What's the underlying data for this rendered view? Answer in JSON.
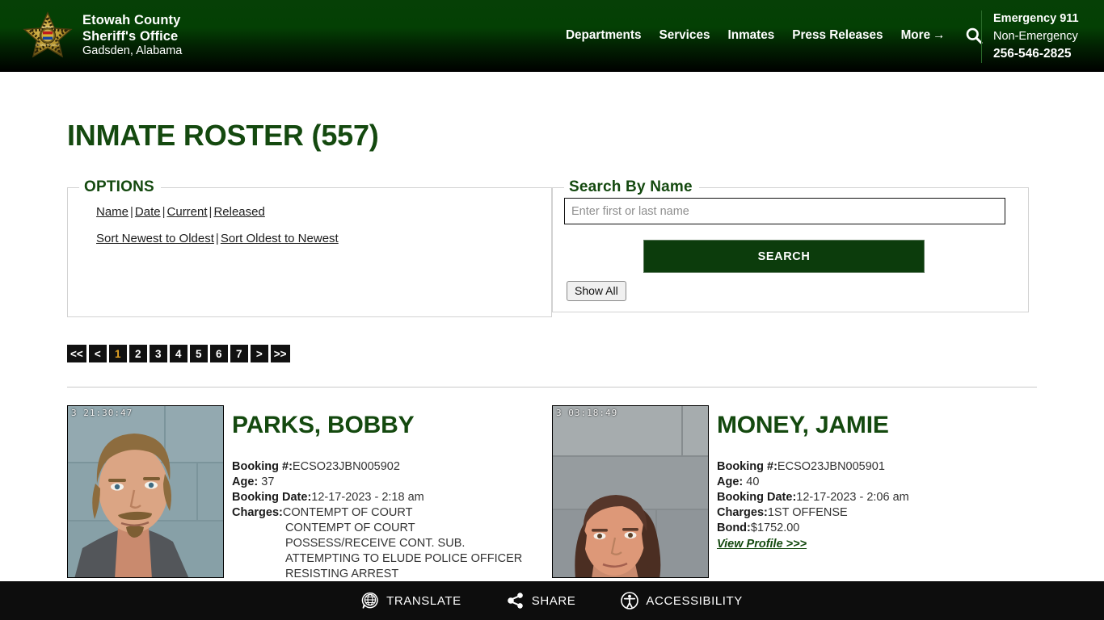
{
  "header": {
    "brand": {
      "line1": "Etowah County",
      "line2": "Sheriff's Office",
      "line3": "Gadsden, Alabama",
      "badge_icon": "sheriff-star-badge"
    },
    "nav": [
      {
        "label": "Departments"
      },
      {
        "label": "Services"
      },
      {
        "label": "Inmates"
      },
      {
        "label": "Press Releases"
      },
      {
        "label": "More",
        "arrow": "→"
      }
    ],
    "search_icon": "search-icon",
    "emergency": {
      "line1": "Emergency 911",
      "line2": "Non-Emergency",
      "line3": "256-546-2825"
    },
    "colors": {
      "green_top": "#064006",
      "black_bottom": "#000000"
    }
  },
  "page": {
    "title": "INMATE ROSTER (557)",
    "title_color": "#14490f"
  },
  "options": {
    "legend": "OPTIONS",
    "row1": [
      {
        "label": "Name"
      },
      {
        "label": "Date"
      },
      {
        "label": "Current"
      },
      {
        "label": "Released"
      }
    ],
    "row2": [
      {
        "label": "Sort Newest to Oldest"
      },
      {
        "label": "Sort Oldest to Newest"
      }
    ],
    "separator": "|"
  },
  "search": {
    "legend": "Search By Name",
    "placeholder": "Enter first or last name",
    "value": "",
    "button_label": "SEARCH",
    "show_all_label": "Show All",
    "button_color": "#0c3c0c"
  },
  "pagination": {
    "items": [
      "<<",
      "<",
      "1",
      "2",
      "3",
      "4",
      "5",
      "6",
      "7",
      ">",
      ">>"
    ],
    "active": "1",
    "active_color": "#e0a124",
    "background": "#111111"
  },
  "results": [
    {
      "name": "PARKS, BOBBY",
      "mug_timestamp": "3  21:30:47",
      "labels": {
        "booking": "Booking #:",
        "age": "Age:",
        "booking_date": "Booking Date:",
        "charges": "Charges:",
        "bond": "Bond:"
      },
      "booking_number": "ECSO23JBN005902",
      "age": "37",
      "booking_date": "12-17-2023 - 2:18 am",
      "charges": [
        "CONTEMPT OF COURT",
        "CONTEMPT OF COURT",
        "POSSESS/RECEIVE CONT. SUB.",
        "ATTEMPTING TO ELUDE POLICE OFFICER",
        "RESISTING ARREST"
      ],
      "bond": null,
      "profile_link": null
    },
    {
      "name": "MONEY, JAMIE",
      "mug_timestamp": "3  03:18:49",
      "labels": {
        "booking": "Booking #:",
        "age": "Age:",
        "booking_date": "Booking Date:",
        "charges": "Charges:",
        "bond": "Bond:"
      },
      "booking_number": "ECSO23JBN005901",
      "age": "40",
      "booking_date": "12-17-2023 - 2:06 am",
      "charges": [
        "1ST OFFENSE"
      ],
      "bond": "$1752.00",
      "profile_link": "View Profile >>>"
    }
  ],
  "bottom_bar": [
    {
      "label": "TRANSLATE",
      "icon": "globe-translate-icon"
    },
    {
      "label": "SHARE",
      "icon": "share-icon"
    },
    {
      "label": "ACCESSIBILITY",
      "icon": "accessibility-icon"
    }
  ]
}
